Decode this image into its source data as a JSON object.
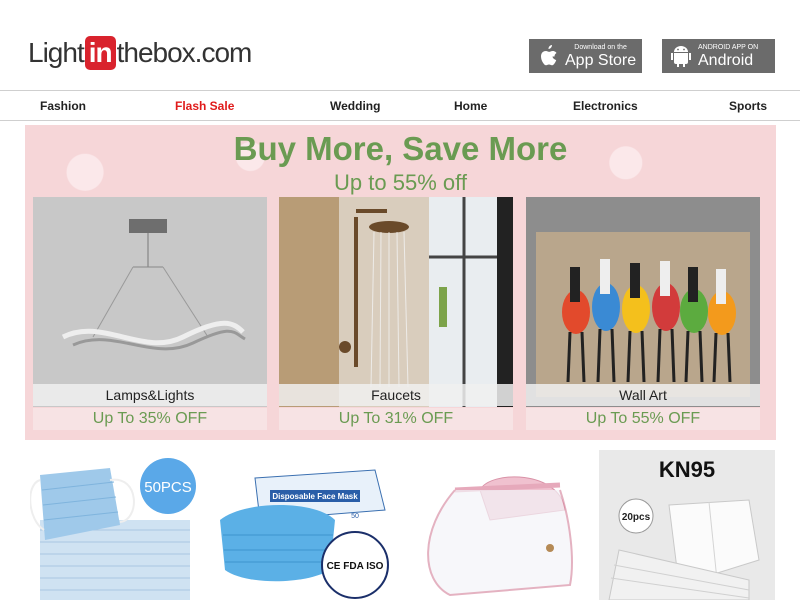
{
  "header": {
    "logo": {
      "part1": "Light",
      "part2": "in",
      "part3": "thebox.com"
    },
    "appstore": {
      "small": "Download on the",
      "big": "App Store"
    },
    "android": {
      "small": "ANDROID APP ON",
      "big": "Android"
    }
  },
  "nav": [
    "Fashion",
    "Flash Sale",
    "Wedding",
    "Home",
    "Electronics",
    "Sports"
  ],
  "banner": {
    "title": "Buy More, Save More",
    "subtitle": "Up to 55% off",
    "categories": [
      {
        "name": "Lamps&Lights",
        "offer": "Up To 35% OFF"
      },
      {
        "name": "Faucets",
        "offer": "Up To 31% OFF"
      },
      {
        "name": "Wall Art",
        "offer": "Up To 55% OFF"
      }
    ]
  },
  "products": [
    {
      "badge": "50PCS",
      "icon": "face-masks-blue"
    },
    {
      "box_text": "Disposable Face Mask",
      "box_count": "50",
      "cert_text": "CE FDA ISO",
      "icon": "face-mask-box"
    },
    {
      "icon": "pink-cap-face-shield"
    },
    {
      "title": "KN95",
      "badge": "20pcs",
      "icon": "kn95-masks"
    }
  ],
  "colors": {
    "brand_red": "#d9232d",
    "sale_red": "#e01b1b",
    "banner_green": "#6a9b52",
    "banner_pink": "#f6d6d8"
  }
}
